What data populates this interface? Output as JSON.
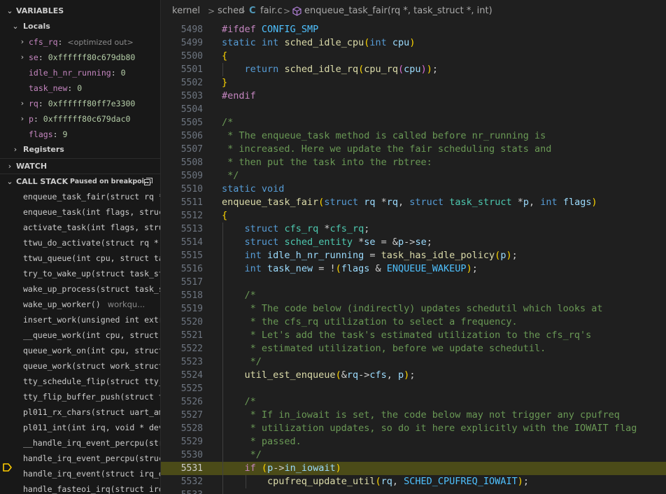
{
  "sidebar": {
    "variables": {
      "title": "VARIABLES",
      "locals_label": "Locals",
      "locals": [
        {
          "name": "cfs_rq",
          "value": "<optimized out>",
          "expandable": true
        },
        {
          "name": "se",
          "value": "0xffffff80c679db80",
          "expandable": true
        },
        {
          "name": "idle_h_nr_running",
          "value": "0",
          "expandable": false
        },
        {
          "name": "task_new",
          "value": "0",
          "expandable": false
        },
        {
          "name": "rq",
          "value": "0xffffff80ff7e3300",
          "expandable": true
        },
        {
          "name": "p",
          "value": "0xffffff80c679dac0",
          "expandable": true
        },
        {
          "name": "flags",
          "value": "9",
          "expandable": false
        }
      ],
      "registers_label": "Registers"
    },
    "watch": {
      "title": "WATCH"
    },
    "call_stack": {
      "title": "CALL STACK",
      "status": "Paused on breakpoi...",
      "frames": [
        {
          "name": "enqueue_task_fair(struct rq *",
          "source": ""
        },
        {
          "name": "enqueue_task(int flags, struct",
          "source": ""
        },
        {
          "name": "activate_task(int flags, struc",
          "source": ""
        },
        {
          "name": "ttwu_do_activate(struct rq * r",
          "source": ""
        },
        {
          "name": "ttwu_queue(int cpu, struct tas",
          "source": ""
        },
        {
          "name": "try_to_wake_up(struct task_str",
          "source": ""
        },
        {
          "name": "wake_up_process(struct task_st",
          "source": ""
        },
        {
          "name": "wake_up_worker()",
          "source": "workqu..."
        },
        {
          "name": "insert_work(unsigned int extra",
          "source": ""
        },
        {
          "name": "__queue_work(int cpu, struct w",
          "source": ""
        },
        {
          "name": "queue_work_on(int cpu, struct w",
          "source": ""
        },
        {
          "name": "queue_work(struct work_struct",
          "source": ""
        },
        {
          "name": "tty_schedule_flip(struct tty_p",
          "source": ""
        },
        {
          "name": "tty_flip_buffer_push(struct tt",
          "source": ""
        },
        {
          "name": "pl011_rx_chars(struct uart_amb",
          "source": ""
        },
        {
          "name": "pl011_int(int irq, void * dev_",
          "source": ""
        },
        {
          "name": "__handle_irq_event_percpu(stru",
          "source": ""
        },
        {
          "name": "handle_irq_event_percpu(struct",
          "source": ""
        },
        {
          "name": "handle_irq_event(struct irq_de",
          "source": ""
        },
        {
          "name": "handle_fasteoi_irq(struct irq_",
          "source": ""
        }
      ]
    }
  },
  "breadcrumb": {
    "items": [
      "kernel",
      "sched",
      "fair.c",
      "enqueue_task_fair(rq *, task_struct *, int)"
    ],
    "separator": ">",
    "file_icon": "C"
  },
  "editor": {
    "current_line": 5531,
    "lines": [
      {
        "n": "5498",
        "text": "#ifdef CONFIG_SMP"
      },
      {
        "n": "5499",
        "text": "static int sched_idle_cpu(int cpu)"
      },
      {
        "n": "5500",
        "text": "{"
      },
      {
        "n": "5501",
        "text": "    return sched_idle_rq(cpu_rq(cpu));"
      },
      {
        "n": "5502",
        "text": "}"
      },
      {
        "n": "5503",
        "text": "#endif"
      },
      {
        "n": "5504",
        "text": ""
      },
      {
        "n": "5505",
        "text": "/*"
      },
      {
        "n": "5506",
        "text": " * The enqueue_task method is called before nr_running is"
      },
      {
        "n": "5507",
        "text": " * increased. Here we update the fair scheduling stats and"
      },
      {
        "n": "5508",
        "text": " * then put the task into the rbtree:"
      },
      {
        "n": "5509",
        "text": " */"
      },
      {
        "n": "5510",
        "text": "static void"
      },
      {
        "n": "5511",
        "text": "enqueue_task_fair(struct rq *rq, struct task_struct *p, int flags)"
      },
      {
        "n": "5512",
        "text": "{"
      },
      {
        "n": "5513",
        "text": "    struct cfs_rq *cfs_rq;"
      },
      {
        "n": "5514",
        "text": "    struct sched_entity *se = &p->se;"
      },
      {
        "n": "5515",
        "text": "    int idle_h_nr_running = task_has_idle_policy(p);"
      },
      {
        "n": "5516",
        "text": "    int task_new = !(flags & ENQUEUE_WAKEUP);"
      },
      {
        "n": "5517",
        "text": ""
      },
      {
        "n": "5518",
        "text": "    /*"
      },
      {
        "n": "5519",
        "text": "     * The code below (indirectly) updates schedutil which looks at"
      },
      {
        "n": "5520",
        "text": "     * the cfs_rq utilization to select a frequency."
      },
      {
        "n": "5521",
        "text": "     * Let's add the task's estimated utilization to the cfs_rq's"
      },
      {
        "n": "5522",
        "text": "     * estimated utilization, before we update schedutil."
      },
      {
        "n": "5523",
        "text": "     */"
      },
      {
        "n": "5524",
        "text": "    util_est_enqueue(&rq->cfs, p);"
      },
      {
        "n": "5525",
        "text": ""
      },
      {
        "n": "5526",
        "text": "    /*"
      },
      {
        "n": "5527",
        "text": "     * If in_iowait is set, the code below may not trigger any cpufreq"
      },
      {
        "n": "5528",
        "text": "     * utilization updates, so do it here explicitly with the IOWAIT flag"
      },
      {
        "n": "5529",
        "text": "     * passed."
      },
      {
        "n": "5530",
        "text": "     */"
      },
      {
        "n": "5531",
        "text": "    if (p->in_iowait)"
      },
      {
        "n": "5532",
        "text": "        cpufreq_update_util(rq, SCHED_CPUFREQ_IOWAIT);"
      },
      {
        "n": "5533",
        "text": ""
      }
    ]
  },
  "colors": {
    "keyword": "#569cd6",
    "control": "#c586c0",
    "function": "#dcdcaa",
    "type": "#4ec9b0",
    "variable": "#9cdcfe",
    "macro": "#4fc1ff",
    "comment": "#6a9955",
    "current_line_bg": "#4b4b18",
    "breakpoint_arrow": "#ffcc00"
  },
  "icons": {
    "chevron_down": "chevron-down-icon",
    "chevron_right": "chevron-right-icon",
    "symbol_method": "symbol-method-icon",
    "breakpoint_current": "debug-stackframe-icon"
  }
}
